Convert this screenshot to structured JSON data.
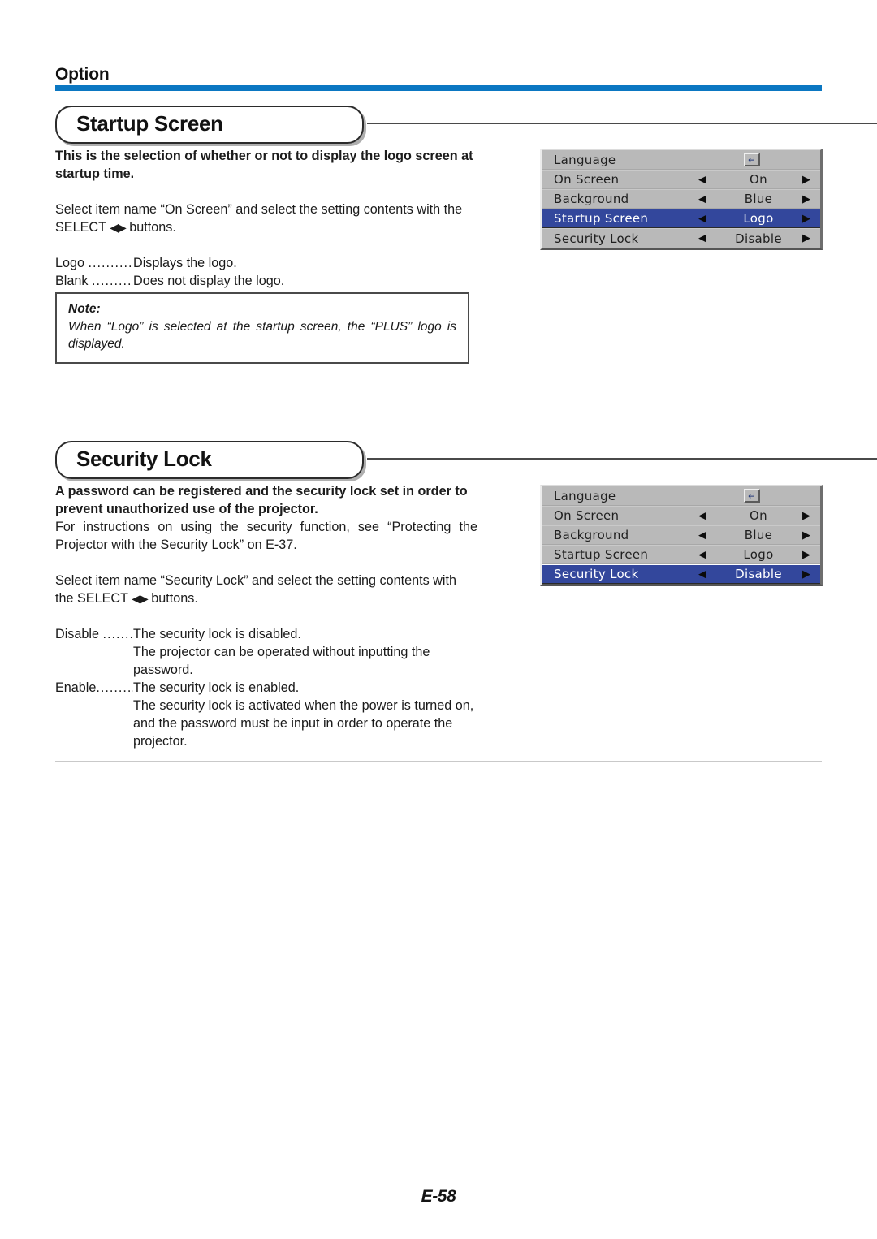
{
  "header": {
    "label": "Option",
    "accent_color": "#0b77c2"
  },
  "sections": [
    {
      "title": "Startup Screen",
      "intro_bold": "This is the selection of whether or not to display the logo screen at startup time.",
      "instruction_prefix": "Select item name “On Screen” and select the setting contents with the SELECT ",
      "instruction_arrows": "◀▶",
      "instruction_suffix": " buttons.",
      "options": [
        {
          "term": "Logo",
          "dots": "...........",
          "desc": "Displays the logo."
        },
        {
          "term": "Blank",
          "dots": "..........",
          "desc": "Does not display the logo."
        }
      ],
      "note": {
        "title": "Note:",
        "body": "When “Logo” is selected at the startup screen, the “PLUS” logo is displayed."
      }
    },
    {
      "title": "Security Lock",
      "intro_bold": "A password can be registered and the security lock set in order to prevent unauthorized use of the projector.",
      "intro_plain": "For instructions on using the security function, see “Protecting the Projector with the Security Lock” on E-37.",
      "instruction_prefix": "Select item name “Security Lock” and select the setting contents with the SELECT ",
      "instruction_arrows": "◀▶",
      "instruction_suffix": " buttons.",
      "options": [
        {
          "term": "Disable",
          "dots": ".......",
          "desc": "The security lock is disabled.",
          "continuation": "The projector can be operated without inputting the password."
        },
        {
          "term": "Enable",
          "dots": ".........",
          "desc": "The security lock is enabled.",
          "continuation": "The security lock is activated when the power is turned on, and the password must be input in order to operate the projector."
        }
      ]
    }
  ],
  "osd_menus": [
    {
      "id": "osd-startup-screen",
      "selected_index": 3,
      "highlight_color": "#33479c",
      "background_color": "#b9b9b9",
      "rows": [
        {
          "name": "Language",
          "value": "",
          "control": "enter-key",
          "left_arrow": "",
          "right_arrow": ""
        },
        {
          "name": "On Screen",
          "value": "On",
          "control": "arrows",
          "left_arrow": "◀",
          "right_arrow": "▶"
        },
        {
          "name": "Background",
          "value": "Blue",
          "control": "arrows",
          "left_arrow": "◀",
          "right_arrow": "▶"
        },
        {
          "name": "Startup Screen",
          "value": "Logo",
          "control": "arrows",
          "left_arrow": "◀",
          "right_arrow": "▶"
        },
        {
          "name": "Security Lock",
          "value": "Disable",
          "control": "arrows",
          "left_arrow": "◀",
          "right_arrow": "▶"
        }
      ]
    },
    {
      "id": "osd-security-lock",
      "selected_index": 4,
      "highlight_color": "#33479c",
      "background_color": "#b9b9b9",
      "rows": [
        {
          "name": "Language",
          "value": "",
          "control": "enter-key",
          "left_arrow": "",
          "right_arrow": ""
        },
        {
          "name": "On Screen",
          "value": "On",
          "control": "arrows",
          "left_arrow": "◀",
          "right_arrow": "▶"
        },
        {
          "name": "Background",
          "value": "Blue",
          "control": "arrows",
          "left_arrow": "◀",
          "right_arrow": "▶"
        },
        {
          "name": "Startup Screen",
          "value": "Logo",
          "control": "arrows",
          "left_arrow": "◀",
          "right_arrow": "▶"
        },
        {
          "name": "Security Lock",
          "value": "Disable",
          "control": "arrows",
          "left_arrow": "◀",
          "right_arrow": "▶"
        }
      ]
    }
  ],
  "enter_key_glyph": "↵",
  "footer": {
    "page_number": "E-58"
  }
}
